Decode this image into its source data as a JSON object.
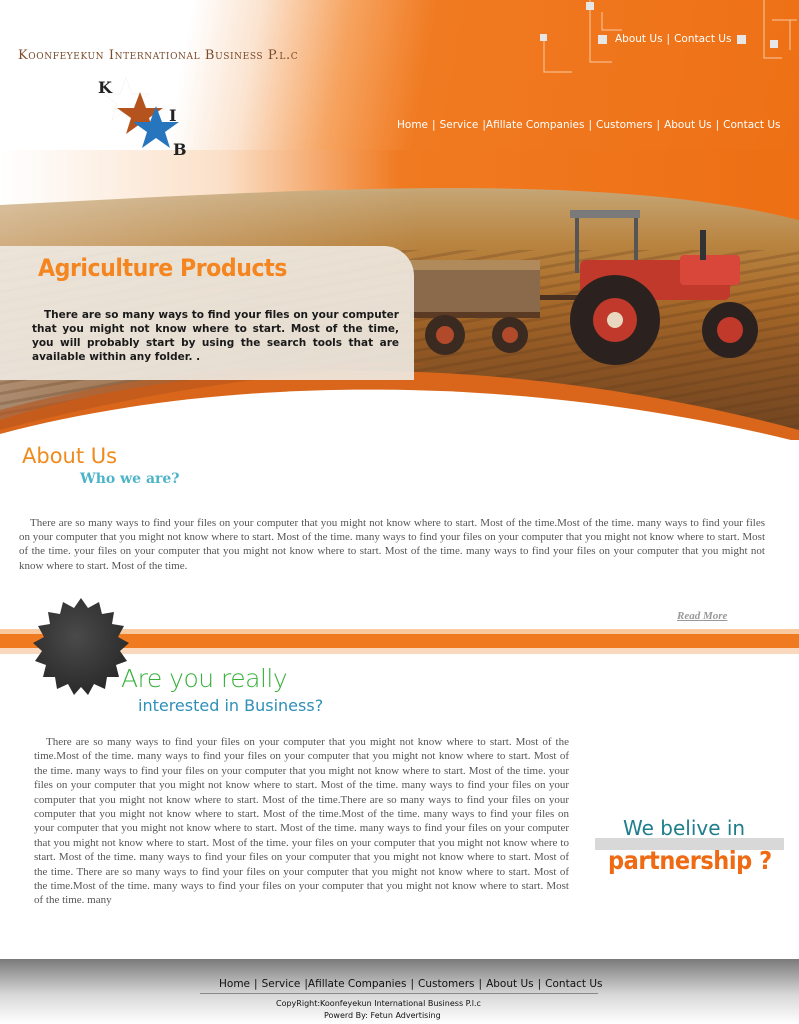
{
  "header": {
    "company_name": "Koonfeyekun International Business P.l.c",
    "logo_letters": {
      "k": "K",
      "i": "I",
      "b": "B"
    },
    "top_links": [
      {
        "label": "About Us"
      },
      {
        "label": "Contact Us"
      }
    ],
    "top_separator": "|",
    "nav": [
      {
        "label": "Home"
      },
      {
        "label": "Service"
      },
      {
        "label": "Afillate Companies"
      },
      {
        "label": "Customers"
      },
      {
        "label": "About Us"
      },
      {
        "label": "Contact Us"
      }
    ],
    "nav_separator": "|"
  },
  "banner": {
    "title": "Agriculture  Products",
    "text": "There are so many ways to find your files on your computer that you might not know where to start. Most of the time, you will probably start by using the search tools that are available within any folder.   ."
  },
  "about": {
    "title": "About Us",
    "subtitle": "Who we are?",
    "text": "There are so many ways to find your files on your computer that you might not know where to start. Most of the time.Most of the time. many ways to find your files on your computer that you might not know where to start. Most of the time. many ways to find your files on your computer that you might not know where to start. Most of the time. your files on your computer that you might not know where to start. Most of the time. many ways to find your files on your computer that you might not know where to start. Most of the time.",
    "read_more": "Read More"
  },
  "business": {
    "title": "Are you really",
    "subtitle": "interested in Business?",
    "text": "There are so many ways to find your files on your computer that you might not know where to start. Most of the time.Most of the time. many ways to find your files on your computer that you might not know where to start. Most of the time. many ways to find your files on your computer that you might not know where to start. Most of the time. your files on your computer that you might not know where to start. Most of the time. many ways to find your files on your computer that you might not know where to start. Most of the time.There are so many ways to find your files on your computer that you might not know where to start. Most of the time.Most of the time. many ways to find your files on your computer that you might not know where to start. Most of the time. many ways to find your files on your computer that you might not know where to start. Most of the time. your files on your computer that you might not know where to start. Most of the time. many ways to find your files on your computer that you might not know where to start. Most of the time.   There are so many ways to find your files on your computer that you might not know where to start. Most of the time.Most of the time. many ways to find your files on your computer that you might not know where to start. Most of the time. many"
  },
  "partnership": {
    "line1": "We belive in",
    "line2": "partnership ?"
  },
  "footer": {
    "nav": [
      {
        "label": "Home"
      },
      {
        "label": "Service"
      },
      {
        "label": "Afillate Companies"
      },
      {
        "label": "Customers"
      },
      {
        "label": "About Us"
      },
      {
        "label": "Contact Us"
      }
    ],
    "nav_separator": "|",
    "copyright": "CopyRight:Koonfeyekun International Business P.l.c",
    "powered": "Powerd By: Fetun Advertising"
  },
  "colors": {
    "accent_orange": "#f07a1f",
    "title_orange": "#f5851f",
    "green": "#36b03a",
    "teal": "#4db3c8",
    "blue": "#2f8fb8"
  }
}
